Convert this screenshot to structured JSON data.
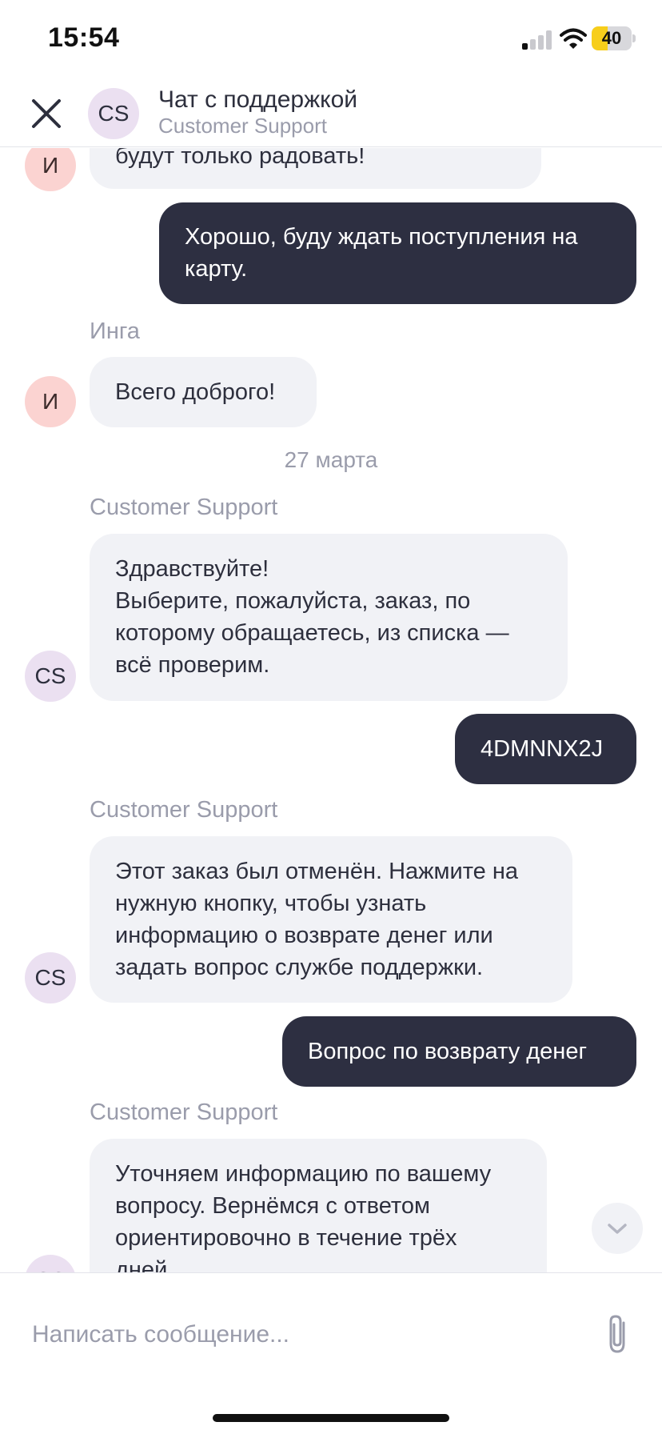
{
  "status_bar": {
    "time": "15:54",
    "battery_level": "40",
    "battery_fraction": 0.4
  },
  "header": {
    "avatar_initials": "CS",
    "title": "Чат с поддержкой",
    "subtitle": "Customer Support"
  },
  "messages": [
    {
      "type": "incoming",
      "avatar": "И",
      "lines": [
        "будут только радовать!"
      ]
    },
    {
      "type": "outgoing",
      "lines": [
        "Хорошо, буду ждать поступления на",
        "карту."
      ]
    },
    {
      "type": "incoming",
      "sender": "Инга",
      "avatar": "И",
      "lines": [
        "Всего доброго!"
      ]
    },
    {
      "type": "date",
      "text": "27 марта"
    },
    {
      "type": "incoming",
      "sender": "Customer Support",
      "avatar": "CS",
      "lines": [
        "Здравствуйте!",
        "Выберите, пожалуйста, заказ, по",
        "которому обращаетесь, из списка —",
        "всё проверим."
      ]
    },
    {
      "type": "outgoing",
      "lines": [
        "4DMNNX2J"
      ]
    },
    {
      "type": "incoming",
      "sender": "Customer Support",
      "avatar": "CS",
      "lines": [
        "Этот заказ был отменён. Нажмите на",
        "нужную кнопку, чтобы узнать",
        "информацию о возврате денег или",
        "задать вопрос службе поддержки."
      ]
    },
    {
      "type": "outgoing",
      "lines": [
        "Вопрос по возврату денег"
      ]
    },
    {
      "type": "incoming",
      "sender": "Customer Support",
      "avatar": "CS",
      "lines": [
        "Уточняем информацию по вашему",
        "вопросу. Вернёмся с ответом",
        "ориентировочно в течение трёх",
        "дней."
      ]
    }
  ],
  "composer": {
    "placeholder": "Написать сообщение..."
  },
  "colors": {
    "outgoing_bubble": "#2d2f41",
    "incoming_bubble": "#f1f2f6",
    "muted_text": "#9a9cab",
    "avatar_cs": "#ebe0f1",
    "avatar_i": "#fbd3d1",
    "battery": "#f7ce1b"
  },
  "icons": {
    "close": "close-icon",
    "attach": "paperclip-icon",
    "scroll": "chevron-down-icon",
    "wifi": "wifi-icon",
    "signal": "signal-icon",
    "battery": "battery-icon"
  }
}
